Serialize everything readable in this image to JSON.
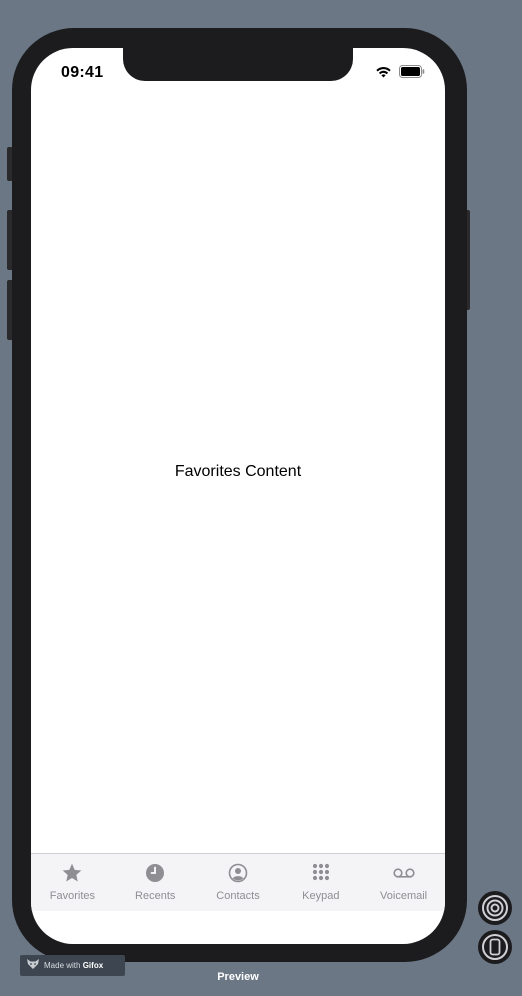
{
  "status_bar": {
    "time": "09:41",
    "icons": [
      "wifi-icon",
      "battery-icon"
    ]
  },
  "main": {
    "content_text": "Favorites Content"
  },
  "tab_bar": {
    "items": [
      {
        "label": "Favorites",
        "icon": "star-icon"
      },
      {
        "label": "Recents",
        "icon": "clock-icon"
      },
      {
        "label": "Contacts",
        "icon": "person-circle-icon"
      },
      {
        "label": "Keypad",
        "icon": "keypad-grid-icon"
      },
      {
        "label": "Voicemail",
        "icon": "voicemail-icon"
      }
    ],
    "colors": {
      "inactive": "#8e8e93",
      "background": "#f4f4f6"
    }
  },
  "overlay": {
    "watermark_prefix": "Made with",
    "watermark_brand": "Gifox",
    "preview_label": "Preview"
  },
  "colors": {
    "canvas_background": "#6b7785",
    "device_frame": "#1c1c1e",
    "screen": "#ffffff"
  }
}
